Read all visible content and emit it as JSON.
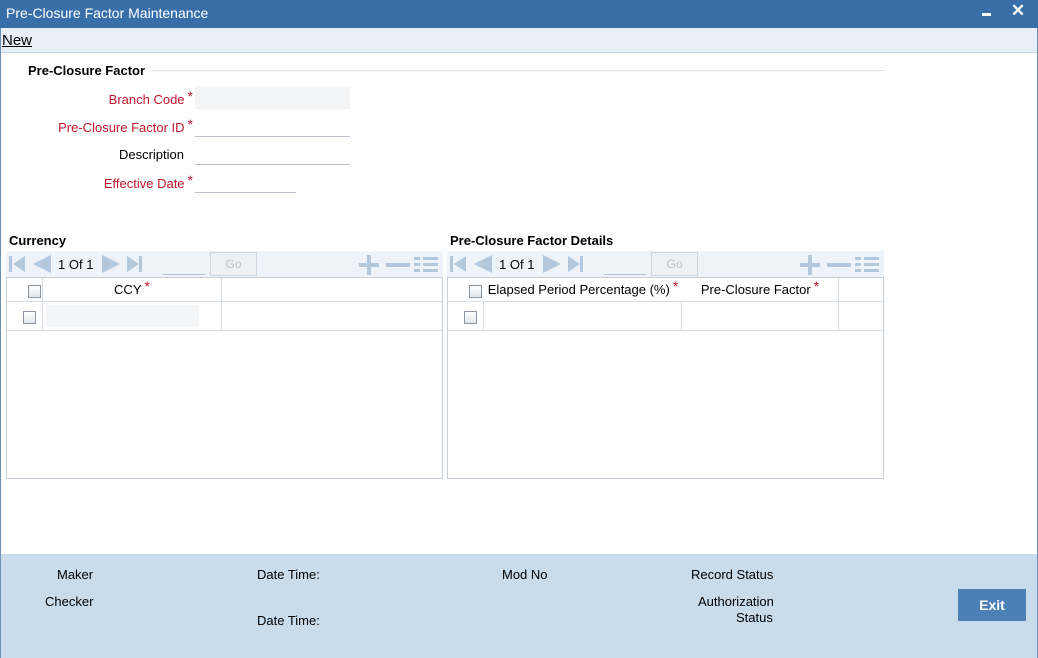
{
  "window": {
    "title": "Pre-Closure Factor Maintenance",
    "minimize_icon": "minimize-icon",
    "close_icon": "close-icon",
    "close_glyph": "✕"
  },
  "toolbar": {
    "new_label": "New"
  },
  "form": {
    "section_title": "Pre-Closure Factor",
    "branch_code_label": "Branch Code",
    "factor_id_label": "Pre-Closure Factor ID",
    "description_label": "Description",
    "effective_date_label": "Effective Date",
    "required_mark": "*",
    "branch_code_value": "",
    "factor_id_value": "",
    "description_value": "",
    "effective_date_value": ""
  },
  "currency_grid": {
    "title": "Currency",
    "page_current": "1",
    "page_of": "Of",
    "page_total": "1",
    "go_label": "Go",
    "columns": [
      "CCY"
    ],
    "required_mark": "*",
    "rows": [
      {
        "ccy": ""
      }
    ]
  },
  "factor_grid": {
    "title": "Pre-Closure Factor Details",
    "page_current": "1",
    "page_of": "Of",
    "page_total": "1",
    "go_label": "Go",
    "columns": [
      "Elapsed Period Percentage (%)",
      "Pre-Closure Factor"
    ],
    "required_mark": "*",
    "rows": [
      {
        "elapsed": "",
        "factor": ""
      }
    ]
  },
  "footer": {
    "maker_label": "Maker",
    "checker_label": "Checker",
    "date_time_label_1": "Date Time:",
    "date_time_label_2": "Date Time:",
    "mod_no_label": "Mod No",
    "record_status_label": "Record Status",
    "authorization_label": "Authorization",
    "authorization_status_label": "Status",
    "exit_label": "Exit"
  },
  "colors": {
    "title_bar": "#386fa8",
    "required": "#c0162b",
    "footer": "#c8dcec",
    "exit_button": "#4b80b6",
    "pager_icons": "#b3c7dd"
  }
}
